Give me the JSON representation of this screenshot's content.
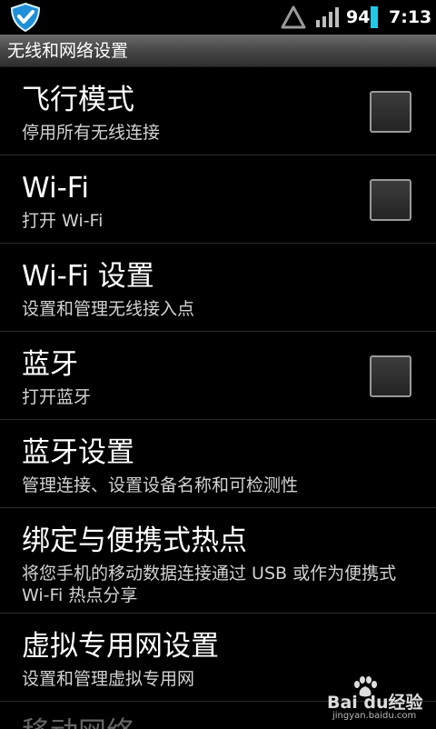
{
  "status_bar": {
    "battery_level": "94",
    "time": "7:13",
    "colors": {
      "app_icon": "#1e8fd8",
      "battery": "#22c8e8"
    }
  },
  "title_bar": {
    "title": "无线和网络设置"
  },
  "settings": {
    "airplane": {
      "title": "飞行模式",
      "summary": "停用所有无线连接",
      "checked": false
    },
    "wifi": {
      "title": "Wi-Fi",
      "summary": "打开 Wi-Fi",
      "checked": false
    },
    "wifi_settings": {
      "title": "Wi-Fi 设置",
      "summary": "设置和管理无线接入点"
    },
    "bluetooth": {
      "title": "蓝牙",
      "summary": "打开蓝牙",
      "checked": false
    },
    "bluetooth_settings": {
      "title": "蓝牙设置",
      "summary": "管理连接、设置设备名称和可检测性"
    },
    "tethering": {
      "title": "绑定与便携式热点",
      "summary": "将您手机的移动数据连接通过 USB 或作为便携式 Wi-Fi 热点分享"
    },
    "vpn": {
      "title": "虚拟专用网设置",
      "summary": "设置和管理虚拟专用网"
    },
    "mobile_network": {
      "title": "移动网络"
    }
  },
  "watermark": {
    "logo": "Bai du经验",
    "site": "jingyan.baidu.com"
  }
}
